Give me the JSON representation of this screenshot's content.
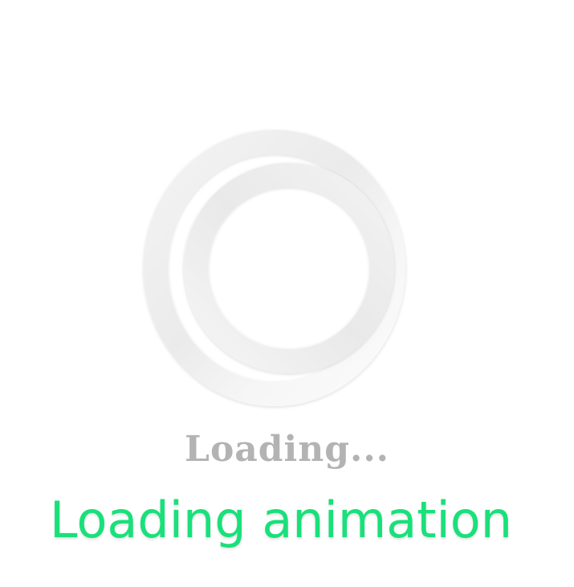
{
  "spinner": {
    "icon": "ring-spinner-icon",
    "colors": {
      "outer_ring": "#efefef",
      "inner_ring": "#ececec",
      "highlight": "#fafafa"
    }
  },
  "status": {
    "text": "Loading...",
    "color": "#b3b3b3"
  },
  "caption": {
    "text": "Loading animation",
    "color": "#19e07a"
  }
}
